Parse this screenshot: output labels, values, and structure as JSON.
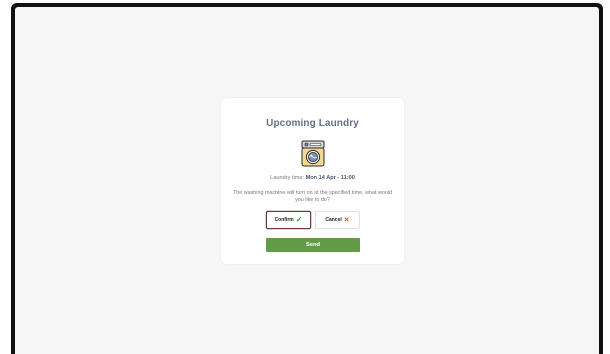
{
  "modal": {
    "title": "Upcoming Laundry",
    "laundry_time_label": "Laundry time:",
    "laundry_time_value": "Mon 14 Apr - 11:00",
    "description": "The washing machine will turn on at the specified time, what would you like to do?",
    "confirm_label": "Confirm",
    "cancel_label": "Cancel",
    "send_label": "Send"
  },
  "icons": {
    "washer": "washing-machine-icon",
    "confirm": "checkmark-icon",
    "cancel": "x-icon"
  },
  "colors": {
    "title": "#5f728a",
    "send_button": "#5f9c45",
    "confirm_check": "#3f9b3f",
    "cancel_x": "#e35a2b",
    "confirm_border": "#6d3a3a",
    "background": "#f6f6f6"
  }
}
